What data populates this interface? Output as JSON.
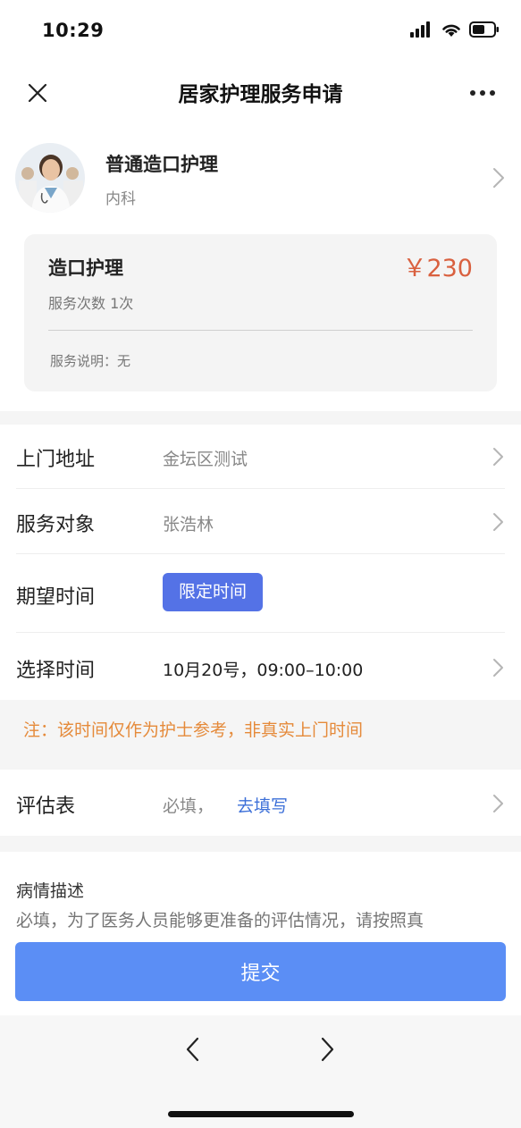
{
  "status_bar": {
    "time": "10:29"
  },
  "nav": {
    "title": "居家护理服务申请"
  },
  "service": {
    "name": "普通造口护理",
    "department": "内科"
  },
  "card": {
    "title": "造口护理",
    "price": "￥230",
    "count": "服务次数 1次",
    "note": "服务说明：无"
  },
  "form": {
    "address": {
      "label": "上门地址",
      "value": "金坛区测试"
    },
    "subject": {
      "label": "服务对象",
      "value": "张浩林"
    },
    "expected_time": {
      "label": "期望时间",
      "option": "限定时间"
    },
    "select_time": {
      "label": "选择时间",
      "value": "10月20号，09:00–10:00"
    },
    "notice": "注：该时间仅作为护士参考，非真实上门时间",
    "assessment": {
      "label": "评估表",
      "required": "必填，",
      "link": "去填写"
    },
    "description": {
      "label": "病情描述",
      "placeholder": "必填，为了医务人员能够更准备的评估情况，请按照真"
    }
  },
  "submit_label": "提交",
  "colors": {
    "accent": "#5b8ef5",
    "pill": "#5472e6",
    "price": "#d9603f",
    "notice": "#e58a3a",
    "link": "#3c6fd8"
  }
}
